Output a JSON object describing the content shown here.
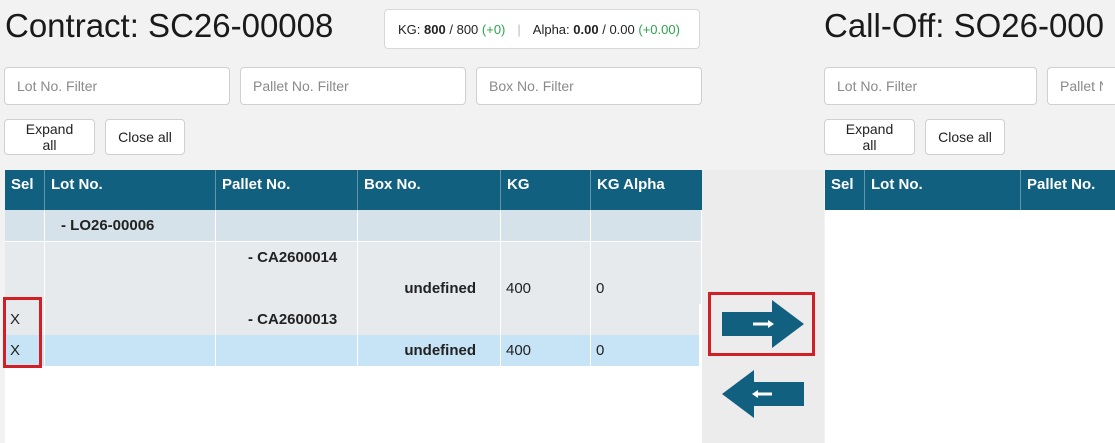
{
  "contract": {
    "title": "Contract: SC26-00008",
    "summary": {
      "kg_label": "KG:",
      "kg_value": "800",
      "kg_total": "/ 800",
      "kg_delta": "(+0)",
      "alpha_label": "Alpha:",
      "alpha_value": "0.00",
      "alpha_total": "/ 0.00",
      "alpha_delta": "(+0.00)"
    },
    "filters": {
      "lot_placeholder": "Lot No. Filter",
      "pallet_placeholder": "Pallet No. Filter",
      "box_placeholder": "Box No. Filter"
    },
    "buttons": {
      "expand_all": "Expand all",
      "close_all": "Close all"
    },
    "grid": {
      "columns": [
        "Sel",
        "Lot No.",
        "Pallet No.",
        "Box No.",
        "KG",
        "KG Alpha"
      ],
      "rows": [
        {
          "sel": "",
          "lot": "-   LO26-00006",
          "pallet": "",
          "box": "",
          "kg": "",
          "alpha": ""
        },
        {
          "sel": "",
          "lot": "",
          "pallet": "-   CA2600014",
          "box": "",
          "kg": "",
          "alpha": ""
        },
        {
          "sel": "",
          "lot": "",
          "pallet": "",
          "box": "undefined",
          "kg": "400",
          "alpha": "0"
        },
        {
          "sel": "X",
          "lot": "",
          "pallet": "-   CA2600013",
          "box": "",
          "kg": "",
          "alpha": ""
        },
        {
          "sel": "X",
          "lot": "",
          "pallet": "",
          "box": "undefined",
          "kg": "400",
          "alpha": "0"
        }
      ]
    }
  },
  "transfer": {
    "move_right_icon": "arrow-right-icon",
    "move_left_icon": "arrow-left-icon",
    "arrow_color": "#12607f",
    "highlight_color": "#d21f26"
  },
  "calloff": {
    "title": "Call-Off: SO26-000",
    "filters": {
      "lot_placeholder": "Lot No. Filter",
      "pallet_placeholder": "Pallet No"
    },
    "buttons": {
      "expand_all": "Expand all",
      "close_all": "Close all"
    },
    "grid": {
      "columns": [
        "Sel",
        "Lot No.",
        "Pallet No."
      ]
    }
  }
}
